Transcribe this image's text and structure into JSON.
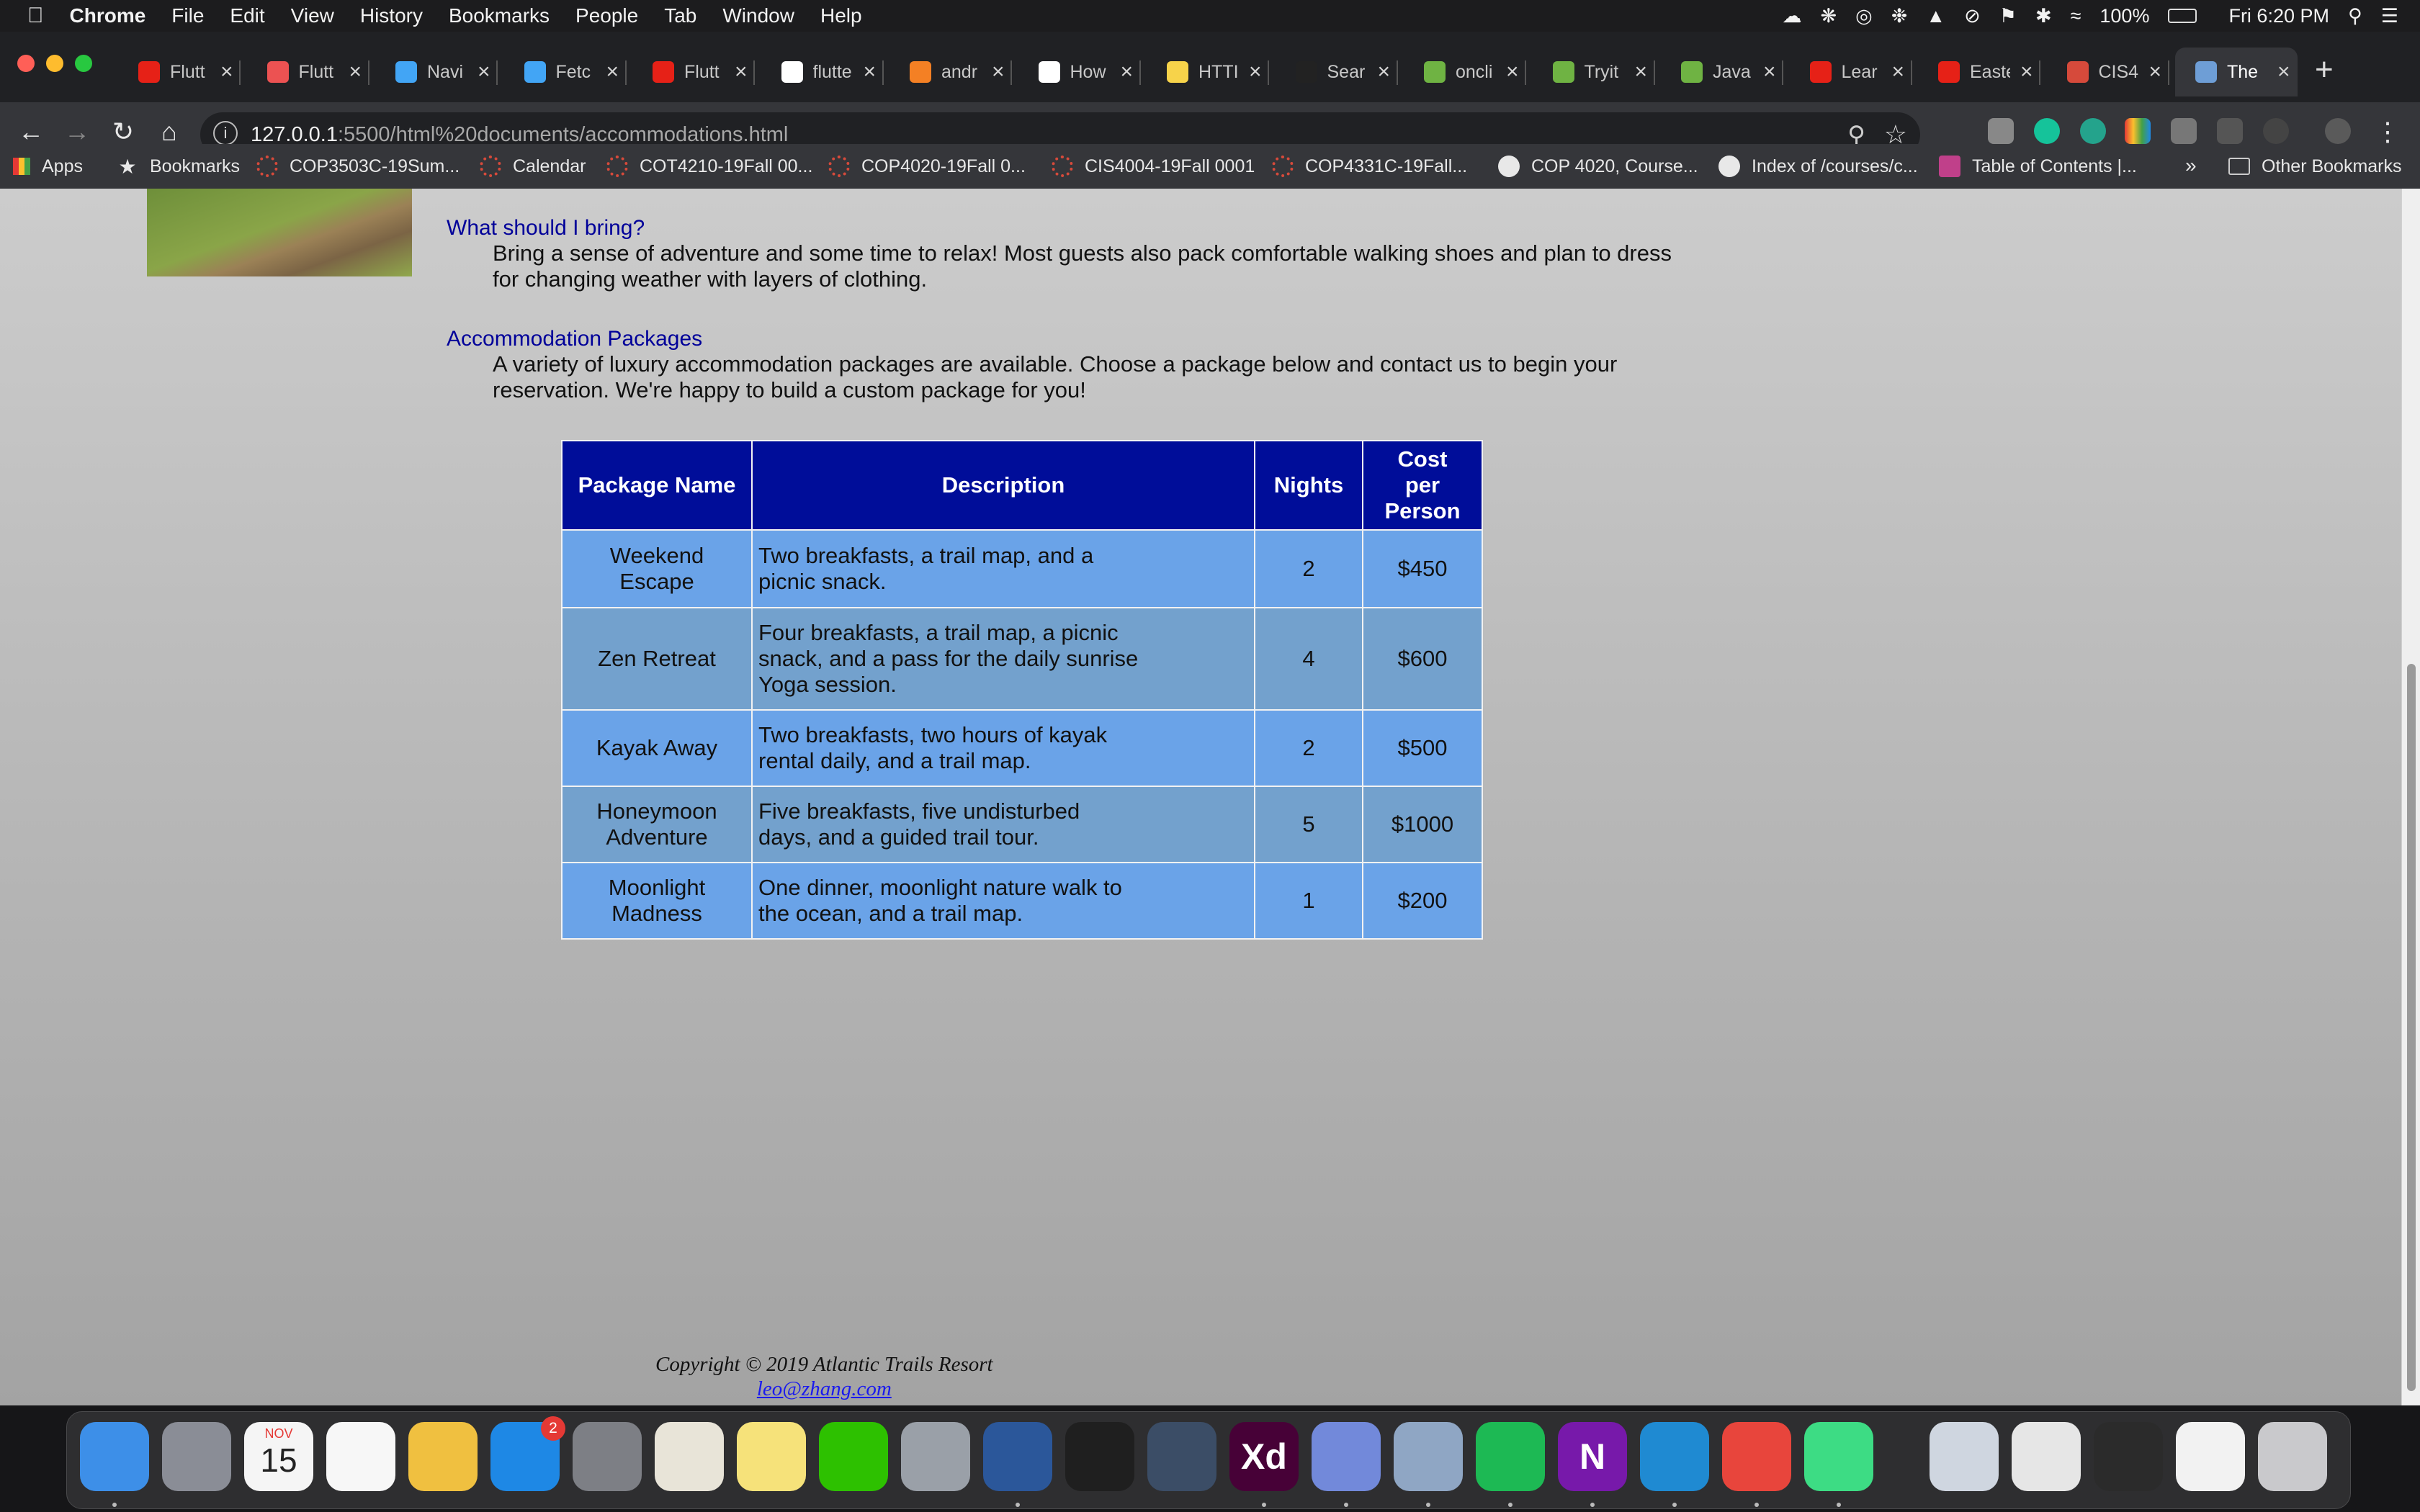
{
  "menubar": {
    "app_name": "Chrome",
    "items": [
      "File",
      "Edit",
      "View",
      "History",
      "Bookmarks",
      "People",
      "Tab",
      "Window",
      "Help"
    ],
    "battery": "100%",
    "clock": "Fri 6:20 PM"
  },
  "tabs": [
    {
      "label": "Flutt",
      "icon": "youtube-icon",
      "color": "#e62117"
    },
    {
      "label": "Flutt",
      "icon": "udemy-icon",
      "color": "#ec5252"
    },
    {
      "label": "Navi",
      "icon": "flutter-icon",
      "color": "#42a5f5"
    },
    {
      "label": "Fetc",
      "icon": "flutter-icon",
      "color": "#42a5f5"
    },
    {
      "label": "Flutt",
      "icon": "youtube-icon",
      "color": "#e62117"
    },
    {
      "label": "flutte",
      "icon": "google-icon",
      "color": "#ffffff"
    },
    {
      "label": "andr",
      "icon": "stackoverflow-icon",
      "color": "#f48024"
    },
    {
      "label": "How",
      "icon": "medium-icon",
      "color": "#ffffff"
    },
    {
      "label": "HTTI",
      "icon": "python-icon",
      "color": "#f7d34a"
    },
    {
      "label": "Sear",
      "icon": "github-icon",
      "color": "#222222"
    },
    {
      "label": "oncli",
      "icon": "w3schools-icon",
      "color": "#6fb343"
    },
    {
      "label": "Tryit",
      "icon": "w3schools-icon",
      "color": "#6fb343"
    },
    {
      "label": "Java",
      "icon": "w3schools-icon",
      "color": "#6fb343"
    },
    {
      "label": "Lear",
      "icon": "youtube-icon",
      "color": "#e62117"
    },
    {
      "label": "Easte",
      "icon": "youtube-icon",
      "color": "#e62117"
    },
    {
      "label": "CIS4",
      "icon": "canvas-icon",
      "color": "#d64a3b"
    },
    {
      "label": "The",
      "icon": "page-icon",
      "color": "#6e9ed6",
      "active": true
    }
  ],
  "address": {
    "host": "127.0.0.1",
    "path": ":5500/html%20documents/accommodations.html"
  },
  "bookmarks": [
    {
      "label": "Apps",
      "icon": "apps-grid-icon"
    },
    {
      "label": "Bookmarks",
      "icon": "star-icon"
    },
    {
      "label": "COP3503C-19Sum...",
      "icon": "canvas-icon"
    },
    {
      "label": "Calendar",
      "icon": "canvas-icon"
    },
    {
      "label": "COT4210-19Fall 00...",
      "icon": "canvas-icon"
    },
    {
      "label": "COP4020-19Fall 0...",
      "icon": "canvas-icon"
    },
    {
      "label": "CIS4004-19Fall 0001",
      "icon": "canvas-icon"
    },
    {
      "label": "COP4331C-19Fall...",
      "icon": "canvas-icon"
    },
    {
      "label": "COP 4020, Course...",
      "icon": "globe-icon"
    },
    {
      "label": "Index of /courses/c...",
      "icon": "globe-icon"
    },
    {
      "label": "Table of Contents |...",
      "icon": "book-icon"
    }
  ],
  "bookmarks_more": "»",
  "other_bookmarks": "Other Bookmarks",
  "page": {
    "q_bring": {
      "heading": "What should I bring?",
      "text": "Bring a sense of adventure and some time to relax! Most guests also pack comfortable walking shoes and plan to dress for changing weather with layers of clothing."
    },
    "q_packages": {
      "heading": "Accommodation Packages",
      "text": "A variety of luxury accommodation packages are available. Choose a package below and contact us to begin your reservation. We're happy to build a custom package for you!"
    },
    "table": {
      "headers": [
        "Package Name",
        "Description",
        "Nights",
        "Cost per Person"
      ],
      "rows": [
        [
          "Weekend Escape",
          "Two breakfasts, a trail map, and a picnic snack.",
          "2",
          "$450"
        ],
        [
          "Zen Retreat",
          "Four breakfasts, a trail map, a picnic snack, and a pass for the daily sunrise Yoga session.",
          "4",
          "$600"
        ],
        [
          "Kayak Away",
          "Two breakfasts, two hours of kayak rental daily, and a trail map.",
          "2",
          "$500"
        ],
        [
          "Honeymoon Adventure",
          "Five breakfasts, five undisturbed days, and a guided trail tour.",
          "5",
          "$1000"
        ],
        [
          "Moonlight Madness",
          "One dinner, moonlight nature walk to the ocean, and a trail map.",
          "1",
          "$200"
        ]
      ]
    },
    "footer": {
      "copyright": "Copyright © 2019 Atlantic Trails Resort",
      "email": "leo@zhang.com"
    }
  },
  "dock": {
    "apps": [
      {
        "name": "finder-icon",
        "color": "#3d8fe8",
        "running": true
      },
      {
        "name": "launchpad-icon",
        "color": "#8a8d96"
      },
      {
        "name": "calendar-icon",
        "color": "#f5f5f5",
        "month": "NOV",
        "day": "15"
      },
      {
        "name": "reminders-icon",
        "color": "#f7f7f7"
      },
      {
        "name": "photos-icon",
        "color": "#f0c040"
      },
      {
        "name": "app-store-icon",
        "color": "#1e88e5",
        "badge": "2"
      },
      {
        "name": "system-preferences-icon",
        "color": "#7d7f85"
      },
      {
        "name": "textedit-icon",
        "color": "#e8e4d8"
      },
      {
        "name": "stickies-icon",
        "color": "#f6e27a"
      },
      {
        "name": "wechat-icon",
        "color": "#2dc100"
      },
      {
        "name": "preview-icon",
        "color": "#9aa0a8"
      },
      {
        "name": "word-icon",
        "color": "#2b579a",
        "running": true
      },
      {
        "name": "terminal-icon",
        "color": "#1f1f1f"
      },
      {
        "name": "quicktime-icon",
        "color": "#3b4d66"
      },
      {
        "name": "adobe-xd-icon",
        "color": "#470137",
        "label": "Xd",
        "running": true
      },
      {
        "name": "discord-icon",
        "color": "#7289da",
        "running": true
      },
      {
        "name": "image-capture-icon",
        "color": "#8fa6c4",
        "running": true
      },
      {
        "name": "spotify-icon",
        "color": "#1db954",
        "running": true
      },
      {
        "name": "onenote-icon",
        "color": "#7719aa",
        "label": "N",
        "running": true
      },
      {
        "name": "vscode-icon",
        "color": "#1f8ad2",
        "running": true
      },
      {
        "name": "chrome-icon",
        "color": "#e8453c",
        "running": true
      },
      {
        "name": "android-studio-icon",
        "color": "#3ddc84",
        "running": true
      },
      {
        "name": "window-thumbnail-icon",
        "color": "#cfd6e0"
      },
      {
        "name": "window-thumbnail-icon",
        "color": "#e6e6e6"
      },
      {
        "name": "window-thumbnail-icon",
        "color": "#2b2b2b"
      },
      {
        "name": "window-thumbnail-icon",
        "color": "#f2f2f2"
      },
      {
        "name": "trash-icon",
        "color": "#c9c9cc"
      }
    ]
  }
}
